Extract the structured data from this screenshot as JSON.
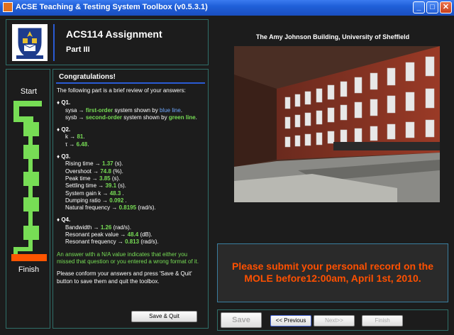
{
  "window": {
    "title": "ACSE Teaching & Testing System Toolbox (v0.5.3.1)",
    "minimize_label": "_",
    "maximize_label": "□",
    "close_label": "✕"
  },
  "header": {
    "title": "ACS114 Assignment",
    "subtitle": "Part III"
  },
  "progress": {
    "start_label": "Start",
    "finish_label": "Finish"
  },
  "review": {
    "heading": "Congratulations!",
    "intro": "The following part is a brief review of your answers:",
    "q1": {
      "label": "Q1.",
      "sysa_name": "sysa",
      "sysa_value": "first-order",
      "sysa_mid": "system shown by",
      "sysa_color": "blue line",
      "sysb_name": "sysb",
      "sysb_value": "second-order",
      "sysb_mid": "system shown by",
      "sysb_color": "green line"
    },
    "q2": {
      "label": "Q2.",
      "k_name": "k",
      "k_value": "81",
      "tau_name": "τ",
      "tau_value": "6.48"
    },
    "q3": {
      "label": "Q3.",
      "items": [
        {
          "name": "Rising time",
          "value": "1.37",
          "unit": "(s)."
        },
        {
          "name": "Overshoot",
          "value": "74.8",
          "unit": "(%)."
        },
        {
          "name": "Peak time",
          "value": "3.85",
          "unit": "(s)."
        },
        {
          "name": "Settling time",
          "value": "39.1",
          "unit": "(s)."
        },
        {
          "name": "System gain k",
          "value": "48.3",
          "unit": "."
        },
        {
          "name": "Dumping ratio",
          "value": "0.092",
          "unit": "."
        },
        {
          "name": "Natural frequency",
          "value": "0.8195",
          "unit": "(rad/s)."
        }
      ]
    },
    "q4": {
      "label": "Q4.",
      "items": [
        {
          "name": "Bandwidth",
          "value": "1.26",
          "unit": "(rad/s)."
        },
        {
          "name": "Resonant peak value",
          "value": "48.4",
          "unit": "(dB)."
        },
        {
          "name": "Resonant frequency",
          "value": "0.813",
          "unit": "(rad/s)."
        }
      ]
    },
    "note": "An answer with a N/A value indicates that either you missed that question or you entered a wrong format of it.",
    "instruction": "Please conform your answers and press 'Save & Quit' button to save them and quit the toolbox.",
    "save_quit_label": "Save & Quit"
  },
  "photo": {
    "caption": "The Amy Johnson Building, University of Sheffield"
  },
  "message": {
    "text": "Please submit your personal record on the MOLE before12:00am, April 1st, 2010."
  },
  "nav": {
    "save_label": "Save",
    "previous_label": "<< Previous",
    "next_label": "Next>>",
    "finish_label": "Finish"
  },
  "colors": {
    "answer_green": "#77dd55",
    "message_orange": "#ff5000",
    "accent_blue": "#2a5bd4",
    "finish_orange": "#ff5500"
  }
}
